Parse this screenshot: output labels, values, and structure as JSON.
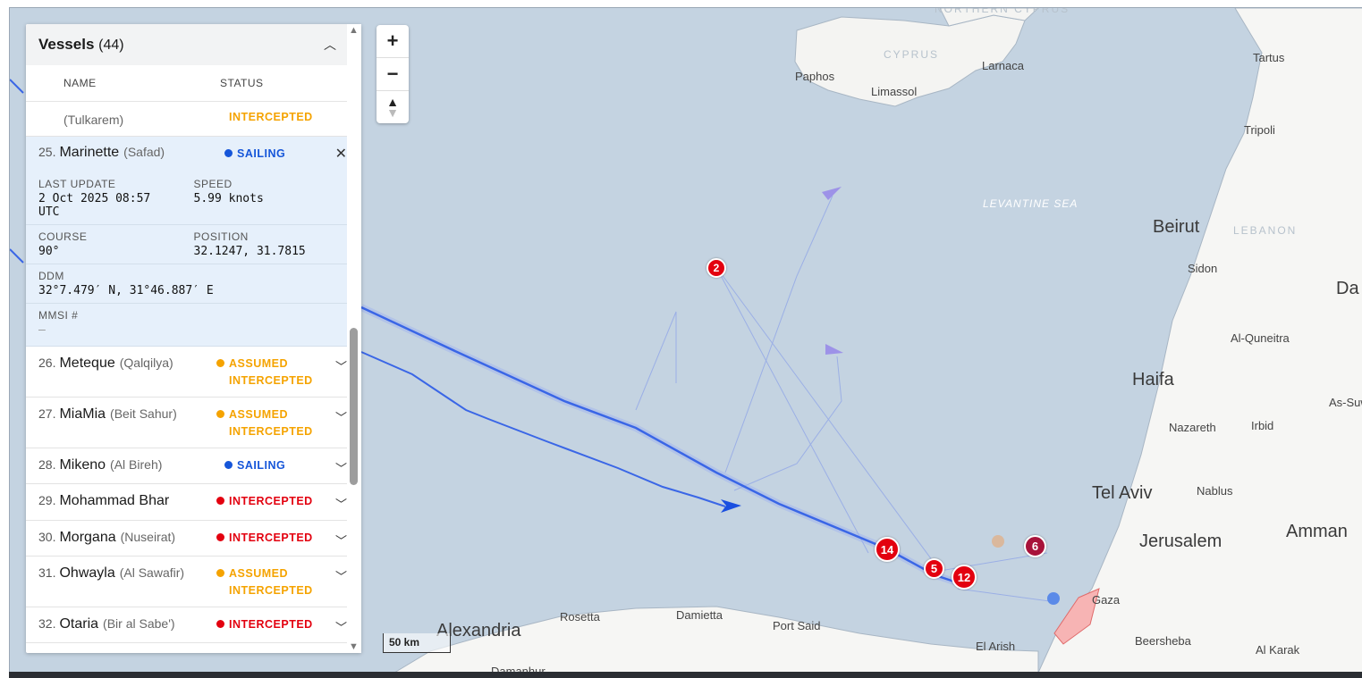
{
  "panel": {
    "title": "Vessels",
    "count": "(44)",
    "col_name": "NAME",
    "col_status": "STATUS",
    "partial_row": {
      "sub": "(Tulkarem)",
      "status": "INTERCEPTED"
    },
    "selected": {
      "num": "25.",
      "name": "Marinette",
      "sub": "(Safad)",
      "status": "SAILING",
      "last_update_label": "LAST UPDATE",
      "last_update_value": "2 Oct 2025 08:57 UTC",
      "speed_label": "SPEED",
      "speed_value": "5.99 knots",
      "course_label": "COURSE",
      "course_value": "90°",
      "position_label": "POSITION",
      "position_value": "32.1247, 31.7815",
      "ddm_label": "DDM",
      "ddm_value": "32°7.479′ N, 31°46.887′ E",
      "mmsi_label": "MMSI #",
      "mmsi_value": "—"
    },
    "rows": [
      {
        "num": "26.",
        "name": "Meteque",
        "sub": "(Qalqilya)",
        "status1": "ASSUMED",
        "status2": "INTERCEPTED"
      },
      {
        "num": "27.",
        "name": "MiaMia",
        "sub": "(Beit Sahur)",
        "status1": "ASSUMED",
        "status2": "INTERCEPTED"
      },
      {
        "num": "28.",
        "name": "Mikeno",
        "sub": "(Al Bireh)",
        "status1": "SAILING"
      },
      {
        "num": "29.",
        "name": "Mohammad Bhar",
        "sub": "",
        "status1": "INTERCEPTED"
      },
      {
        "num": "30.",
        "name": "Morgana",
        "sub": "(Nuseirat)",
        "status1": "INTERCEPTED"
      },
      {
        "num": "31.",
        "name": "Ohwayla",
        "sub": "(Al Sawafir)",
        "status1": "ASSUMED",
        "status2": "INTERCEPTED"
      },
      {
        "num": "32.",
        "name": "Otaria",
        "sub": "(Bir al Sabe')",
        "status1": "INTERCEPTED"
      }
    ]
  },
  "map": {
    "scale": "50 km",
    "labels": {
      "northern_cyprus": "NORTHERN CYPRUS",
      "cyprus": "CYPRUS",
      "paphos": "Paphos",
      "limassol": "Limassol",
      "larnaca": "Larnaca",
      "tartus": "Tartus",
      "tripoli": "Tripoli",
      "levantine": "LEVANTINE SEA",
      "beirut": "Beirut",
      "lebanon": "LEBANON",
      "sidon": "Sidon",
      "damascus": "Da",
      "alquneitra": "Al-Quneitra",
      "haifa": "Haifa",
      "assuw": "As-Suw",
      "nazareth": "Nazareth",
      "irbid": "Irbid",
      "telaviv": "Tel Aviv",
      "nablus": "Nablus",
      "jerusalem": "Jerusalem",
      "amman": "Amman",
      "gaza": "Gaza",
      "beersheba": "Beersheba",
      "alkarak": "Al Karak",
      "elarish": "El Arish",
      "portsaid": "Port Said",
      "damietta": "Damietta",
      "rosetta": "Rosetta",
      "alexandria": "Alexandria",
      "damanhur": "Damanhur"
    },
    "clusters": [
      "2",
      "14",
      "5",
      "12",
      "6"
    ],
    "colors": {
      "sea": "#c4d3e1",
      "track": "#3a66e6",
      "cluster": "#e3000f",
      "gaza": "#f7b4b4"
    }
  }
}
